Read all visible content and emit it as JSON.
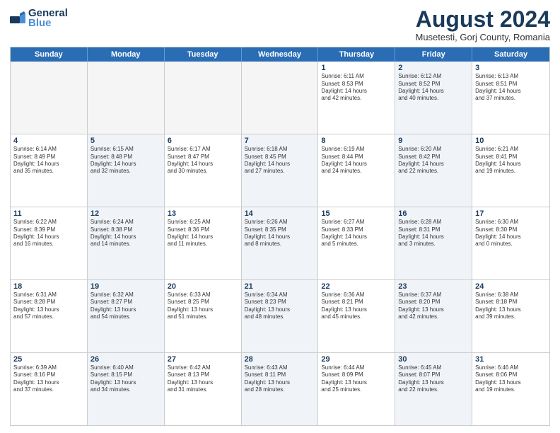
{
  "logo": {
    "line1": "General",
    "line2": "Blue"
  },
  "title": "August 2024",
  "subtitle": "Musetesti, Gorj County, Romania",
  "headers": [
    "Sunday",
    "Monday",
    "Tuesday",
    "Wednesday",
    "Thursday",
    "Friday",
    "Saturday"
  ],
  "rows": [
    [
      {
        "day": "",
        "info": "",
        "shaded": false,
        "empty": true
      },
      {
        "day": "",
        "info": "",
        "shaded": false,
        "empty": true
      },
      {
        "day": "",
        "info": "",
        "shaded": false,
        "empty": true
      },
      {
        "day": "",
        "info": "",
        "shaded": false,
        "empty": true
      },
      {
        "day": "1",
        "info": "Sunrise: 6:11 AM\nSunset: 8:53 PM\nDaylight: 14 hours\nand 42 minutes.",
        "shaded": false,
        "empty": false
      },
      {
        "day": "2",
        "info": "Sunrise: 6:12 AM\nSunset: 8:52 PM\nDaylight: 14 hours\nand 40 minutes.",
        "shaded": true,
        "empty": false
      },
      {
        "day": "3",
        "info": "Sunrise: 6:13 AM\nSunset: 8:51 PM\nDaylight: 14 hours\nand 37 minutes.",
        "shaded": false,
        "empty": false
      }
    ],
    [
      {
        "day": "4",
        "info": "Sunrise: 6:14 AM\nSunset: 8:49 PM\nDaylight: 14 hours\nand 35 minutes.",
        "shaded": false,
        "empty": false
      },
      {
        "day": "5",
        "info": "Sunrise: 6:15 AM\nSunset: 8:48 PM\nDaylight: 14 hours\nand 32 minutes.",
        "shaded": true,
        "empty": false
      },
      {
        "day": "6",
        "info": "Sunrise: 6:17 AM\nSunset: 8:47 PM\nDaylight: 14 hours\nand 30 minutes.",
        "shaded": false,
        "empty": false
      },
      {
        "day": "7",
        "info": "Sunrise: 6:18 AM\nSunset: 8:45 PM\nDaylight: 14 hours\nand 27 minutes.",
        "shaded": true,
        "empty": false
      },
      {
        "day": "8",
        "info": "Sunrise: 6:19 AM\nSunset: 8:44 PM\nDaylight: 14 hours\nand 24 minutes.",
        "shaded": false,
        "empty": false
      },
      {
        "day": "9",
        "info": "Sunrise: 6:20 AM\nSunset: 8:42 PM\nDaylight: 14 hours\nand 22 minutes.",
        "shaded": true,
        "empty": false
      },
      {
        "day": "10",
        "info": "Sunrise: 6:21 AM\nSunset: 8:41 PM\nDaylight: 14 hours\nand 19 minutes.",
        "shaded": false,
        "empty": false
      }
    ],
    [
      {
        "day": "11",
        "info": "Sunrise: 6:22 AM\nSunset: 8:39 PM\nDaylight: 14 hours\nand 16 minutes.",
        "shaded": false,
        "empty": false
      },
      {
        "day": "12",
        "info": "Sunrise: 6:24 AM\nSunset: 8:38 PM\nDaylight: 14 hours\nand 14 minutes.",
        "shaded": true,
        "empty": false
      },
      {
        "day": "13",
        "info": "Sunrise: 6:25 AM\nSunset: 8:36 PM\nDaylight: 14 hours\nand 11 minutes.",
        "shaded": false,
        "empty": false
      },
      {
        "day": "14",
        "info": "Sunrise: 6:26 AM\nSunset: 8:35 PM\nDaylight: 14 hours\nand 8 minutes.",
        "shaded": true,
        "empty": false
      },
      {
        "day": "15",
        "info": "Sunrise: 6:27 AM\nSunset: 8:33 PM\nDaylight: 14 hours\nand 5 minutes.",
        "shaded": false,
        "empty": false
      },
      {
        "day": "16",
        "info": "Sunrise: 6:28 AM\nSunset: 8:31 PM\nDaylight: 14 hours\nand 3 minutes.",
        "shaded": true,
        "empty": false
      },
      {
        "day": "17",
        "info": "Sunrise: 6:30 AM\nSunset: 8:30 PM\nDaylight: 14 hours\nand 0 minutes.",
        "shaded": false,
        "empty": false
      }
    ],
    [
      {
        "day": "18",
        "info": "Sunrise: 6:31 AM\nSunset: 8:28 PM\nDaylight: 13 hours\nand 57 minutes.",
        "shaded": false,
        "empty": false
      },
      {
        "day": "19",
        "info": "Sunrise: 6:32 AM\nSunset: 8:27 PM\nDaylight: 13 hours\nand 54 minutes.",
        "shaded": true,
        "empty": false
      },
      {
        "day": "20",
        "info": "Sunrise: 6:33 AM\nSunset: 8:25 PM\nDaylight: 13 hours\nand 51 minutes.",
        "shaded": false,
        "empty": false
      },
      {
        "day": "21",
        "info": "Sunrise: 6:34 AM\nSunset: 8:23 PM\nDaylight: 13 hours\nand 48 minutes.",
        "shaded": true,
        "empty": false
      },
      {
        "day": "22",
        "info": "Sunrise: 6:36 AM\nSunset: 8:21 PM\nDaylight: 13 hours\nand 45 minutes.",
        "shaded": false,
        "empty": false
      },
      {
        "day": "23",
        "info": "Sunrise: 6:37 AM\nSunset: 8:20 PM\nDaylight: 13 hours\nand 42 minutes.",
        "shaded": true,
        "empty": false
      },
      {
        "day": "24",
        "info": "Sunrise: 6:38 AM\nSunset: 8:18 PM\nDaylight: 13 hours\nand 39 minutes.",
        "shaded": false,
        "empty": false
      }
    ],
    [
      {
        "day": "25",
        "info": "Sunrise: 6:39 AM\nSunset: 8:16 PM\nDaylight: 13 hours\nand 37 minutes.",
        "shaded": false,
        "empty": false
      },
      {
        "day": "26",
        "info": "Sunrise: 6:40 AM\nSunset: 8:15 PM\nDaylight: 13 hours\nand 34 minutes.",
        "shaded": true,
        "empty": false
      },
      {
        "day": "27",
        "info": "Sunrise: 6:42 AM\nSunset: 8:13 PM\nDaylight: 13 hours\nand 31 minutes.",
        "shaded": false,
        "empty": false
      },
      {
        "day": "28",
        "info": "Sunrise: 6:43 AM\nSunset: 8:11 PM\nDaylight: 13 hours\nand 28 minutes.",
        "shaded": true,
        "empty": false
      },
      {
        "day": "29",
        "info": "Sunrise: 6:44 AM\nSunset: 8:09 PM\nDaylight: 13 hours\nand 25 minutes.",
        "shaded": false,
        "empty": false
      },
      {
        "day": "30",
        "info": "Sunrise: 6:45 AM\nSunset: 8:07 PM\nDaylight: 13 hours\nand 22 minutes.",
        "shaded": true,
        "empty": false
      },
      {
        "day": "31",
        "info": "Sunrise: 6:46 AM\nSunset: 8:06 PM\nDaylight: 13 hours\nand 19 minutes.",
        "shaded": false,
        "empty": false
      }
    ]
  ]
}
